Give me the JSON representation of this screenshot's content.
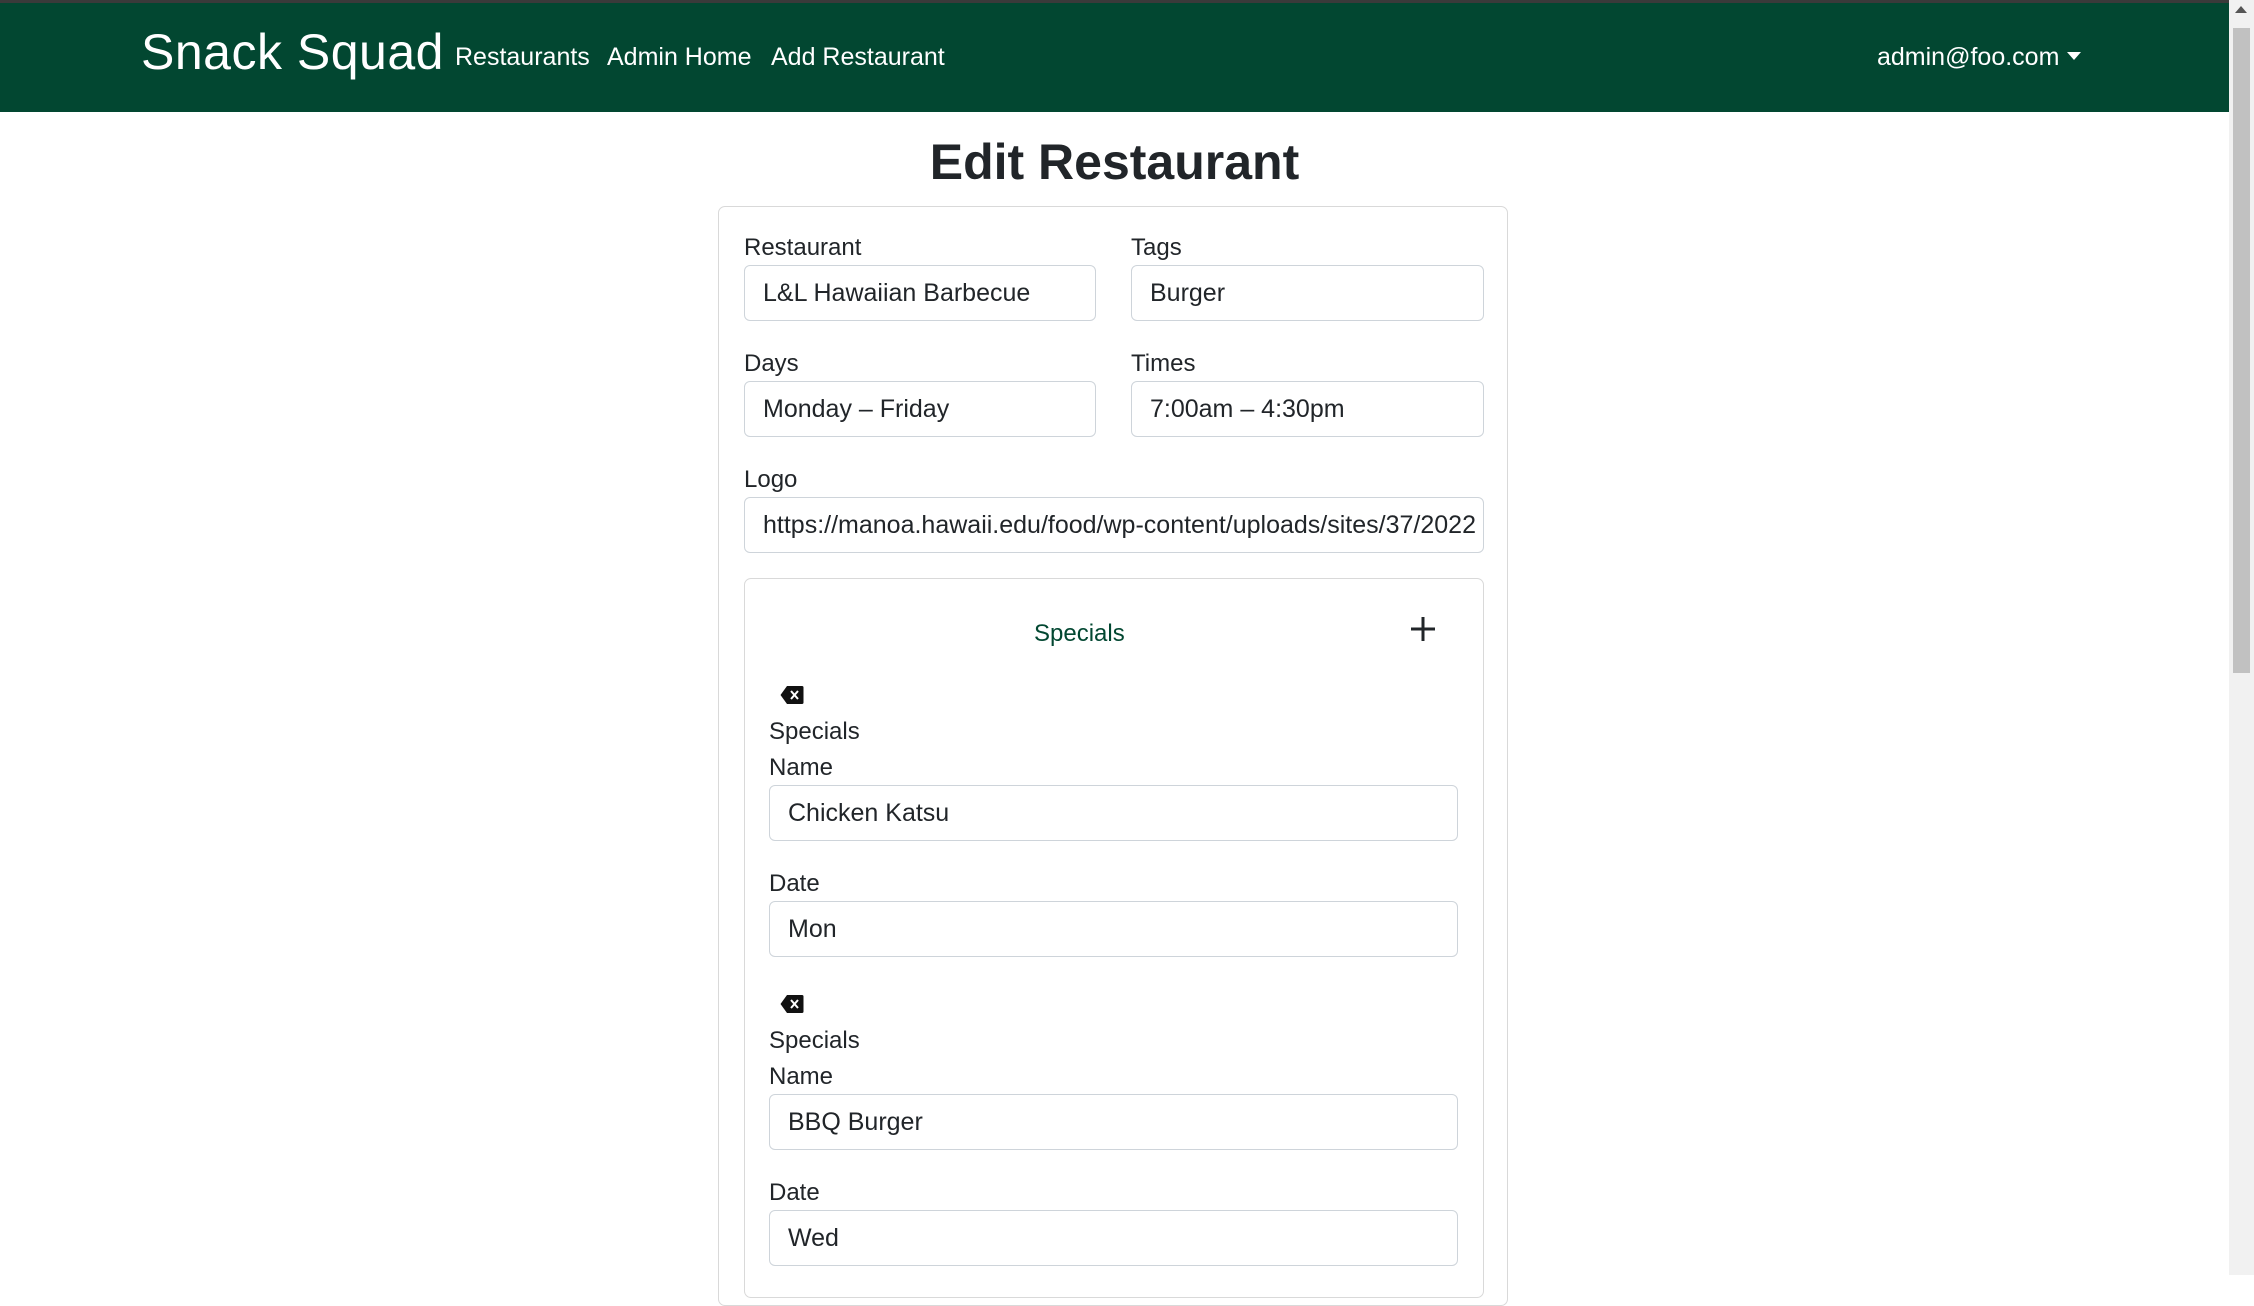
{
  "navbar": {
    "brand": "Snack Squad",
    "links": [
      "Restaurants",
      "Admin Home",
      "Add Restaurant"
    ],
    "user": "admin@foo.com"
  },
  "page": {
    "title": "Edit Restaurant"
  },
  "form": {
    "restaurant": {
      "label": "Restaurant",
      "value": "L&L Hawaiian Barbecue"
    },
    "tags": {
      "label": "Tags",
      "value": "Burger"
    },
    "days": {
      "label": "Days",
      "value": "Monday – Friday"
    },
    "times": {
      "label": "Times",
      "value": "7:00am – 4:30pm"
    },
    "logo": {
      "label": "Logo",
      "value": "https://manoa.hawaii.edu/food/wp-content/uploads/sites/37/2022"
    }
  },
  "specials": {
    "title": "Specials",
    "items": [
      {
        "section_label": "Specials",
        "name_label": "Name",
        "name": "Chicken Katsu",
        "date_label": "Date",
        "date": "Mon"
      },
      {
        "section_label": "Specials",
        "name_label": "Name",
        "name": "BBQ Burger",
        "date_label": "Date",
        "date": "Wed"
      }
    ]
  },
  "icons": {
    "add": "plus-icon",
    "remove": "backspace-icon"
  },
  "colors": {
    "navbar": "#024731",
    "text": "#212529",
    "border": "#ced4da"
  }
}
